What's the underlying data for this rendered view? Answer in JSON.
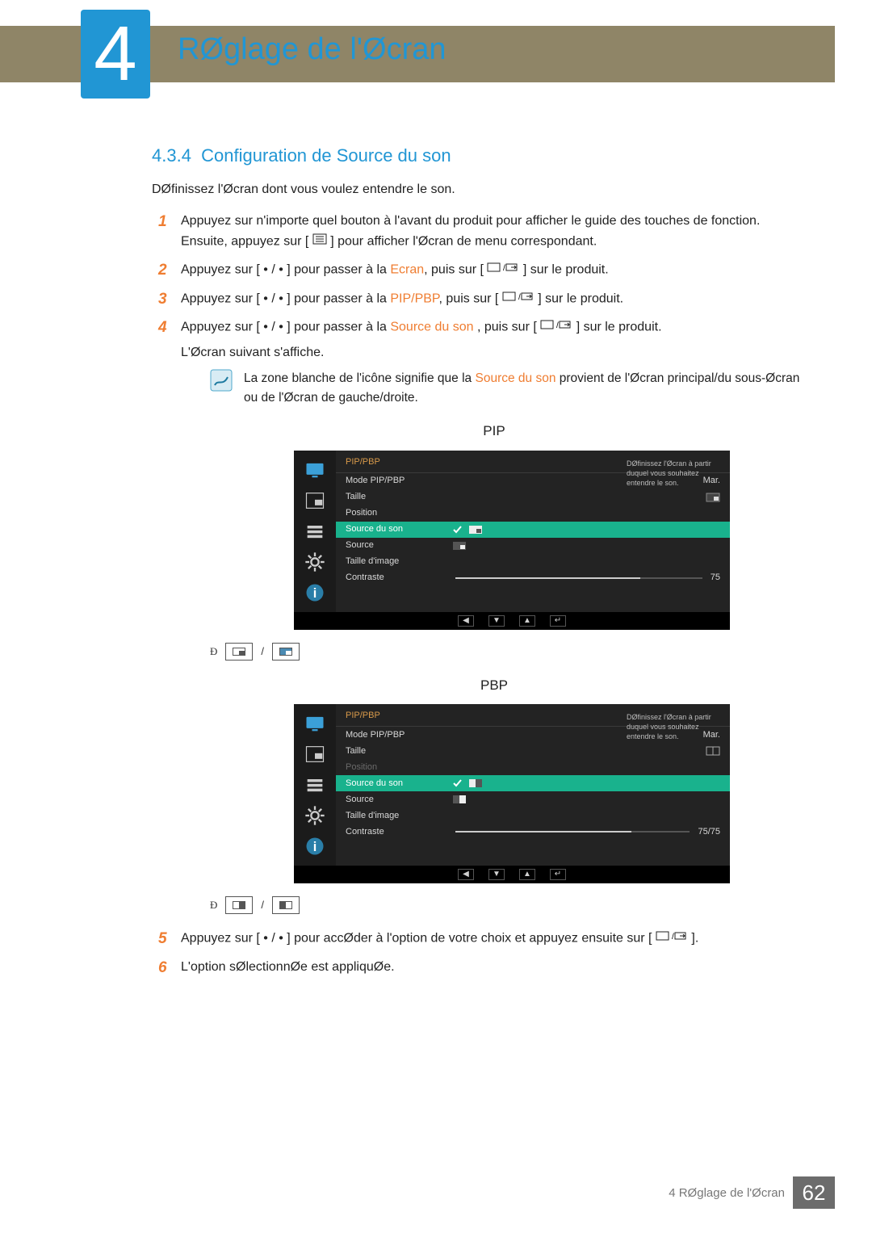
{
  "chapter": {
    "number": "4",
    "title": "RØglage de l'Øcran"
  },
  "section": {
    "number": "4.3.4",
    "title": "Configuration de Source du son"
  },
  "intro": "DØfinissez l'Øcran dont vous voulez entendre le son.",
  "steps": {
    "s1a": "Appuyez sur n'importe quel bouton à l'avant du produit pour afficher le guide des touches de fonction. Ensuite, appuyez sur [",
    "s1b": "] pour afficher l'Øcran de menu correspondant.",
    "s2a": "Appuyez sur [",
    "s2b": "] pour passer à la ",
    "s2c": "Ecran",
    "s2d": ", puis sur [",
    "s2e": "] sur le produit.",
    "s3a": "Appuyez sur [",
    "s3b": "] pour passer à la ",
    "s3c": "PIP/PBP",
    "s3d": ", puis sur [",
    "s3e": "] sur le produit.",
    "s4a": "Appuyez sur [",
    "s4b": "] pour passer à la ",
    "s4c": "Source du son",
    "s4d": " , puis sur [",
    "s4e": "] sur le produit.",
    "s4f": "L'Øcran suivant s'affiche.",
    "s5a": "Appuyez sur [",
    "s5b": "] pour accØder à l'option de votre choix et appuyez ensuite sur [",
    "s5c": "].",
    "s6": "L'option sØlectionnØe est appliquØe."
  },
  "dots": " • / • ",
  "note": {
    "a": "La zone blanche de l'icône signifie que la ",
    "hl": "Source du son",
    "b": " provient de l'Øcran principal/du sous-Øcran ou de l'Øcran de gauche/droite."
  },
  "osd": {
    "pip_label": "PIP",
    "pbp_label": "PBP",
    "header": "PIP/PBP",
    "tip": "DØfinissez l'Øcran à partir duquel vous souhaitez entendre le son.",
    "rows": {
      "mode": "Mode PIP/PBP",
      "taille": "Taille",
      "position": "Position",
      "source_son": "Source du son",
      "source": "Source",
      "taille_img": "Taille d'image",
      "contraste": "Contraste"
    },
    "vals": {
      "mode_pip": "Mar.",
      "mode_pbp": "Mar.",
      "contraste_pip": "75",
      "contraste_pbp": "75/75"
    }
  },
  "footer": {
    "text": "4 RØglage de l'Øcran",
    "page": "62"
  }
}
